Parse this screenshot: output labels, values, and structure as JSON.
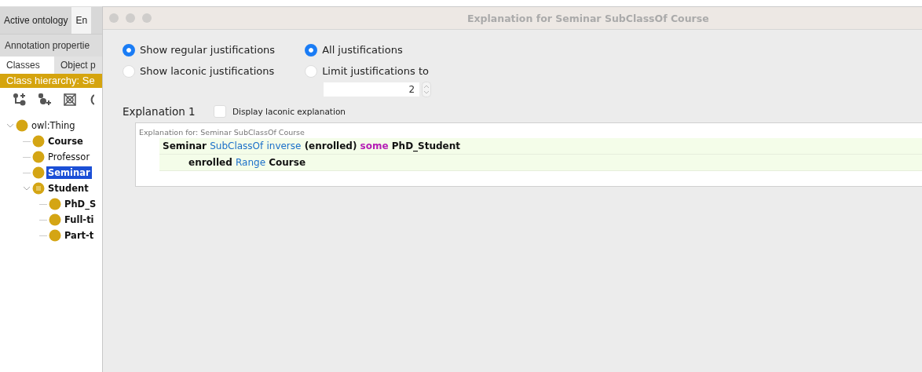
{
  "main_window": {
    "tabs": [
      {
        "label": "Active ontology",
        "selected": false
      },
      {
        "label": "En",
        "selected": true
      }
    ],
    "sub_tabs": [
      {
        "label": "Annotation propertie"
      }
    ],
    "view_tabs": [
      {
        "label": "Classes",
        "selected": true
      },
      {
        "label": "Object p",
        "selected": false
      }
    ],
    "view_title": "Class hierarchy: Se",
    "tree": [
      {
        "label": "owl:Thing",
        "kind": "primitive",
        "bold": false,
        "selected": false,
        "expanded": true,
        "children": [
          {
            "label": "Course",
            "kind": "primitive",
            "bold": true,
            "selected": false
          },
          {
            "label": "Professor",
            "kind": "primitive",
            "bold": false,
            "selected": false
          },
          {
            "label": "Seminar",
            "kind": "primitive",
            "bold": true,
            "selected": true
          },
          {
            "label": "Student",
            "kind": "defined",
            "bold": true,
            "selected": false,
            "expanded": true,
            "children": [
              {
                "label": "PhD_S",
                "kind": "primitive",
                "bold": true,
                "selected": false
              },
              {
                "label": "Full-ti",
                "kind": "primitive",
                "bold": true,
                "selected": false
              },
              {
                "label": "Part-t",
                "kind": "primitive",
                "bold": true,
                "selected": false
              }
            ]
          }
        ]
      }
    ]
  },
  "dialog": {
    "title": "Explanation for Seminar SubClassOf Course",
    "justification_type": [
      {
        "label": "Show regular justifications",
        "selected": true
      },
      {
        "label": "Show laconic justifications",
        "selected": false
      }
    ],
    "justification_count": [
      {
        "label": "All justifications",
        "selected": true
      },
      {
        "label": "Limit justifications to",
        "selected": false
      }
    ],
    "limit_value": "2",
    "explanation": {
      "heading": "Explanation 1",
      "laconic_checkbox": {
        "label": "Display laconic explanation",
        "checked": false
      },
      "caption": "Explanation for: Seminar SubClassOf Course",
      "axioms": [
        {
          "tokens": [
            {
              "text": "Seminar",
              "kind": "entity"
            },
            {
              "text": "SubClassOf",
              "kind": "keyword"
            },
            {
              "text": "inverse",
              "kind": "keyword"
            },
            {
              "text": "(enrolled)",
              "kind": "entity"
            },
            {
              "text": "some",
              "kind": "quantifier"
            },
            {
              "text": "PhD_Student",
              "kind": "entity"
            }
          ],
          "children": [
            {
              "tokens": [
                {
                  "text": "enrolled",
                  "kind": "entity"
                },
                {
                  "text": "Range",
                  "kind": "keyword"
                },
                {
                  "text": "Course",
                  "kind": "entity"
                }
              ]
            }
          ]
        }
      ]
    }
  }
}
